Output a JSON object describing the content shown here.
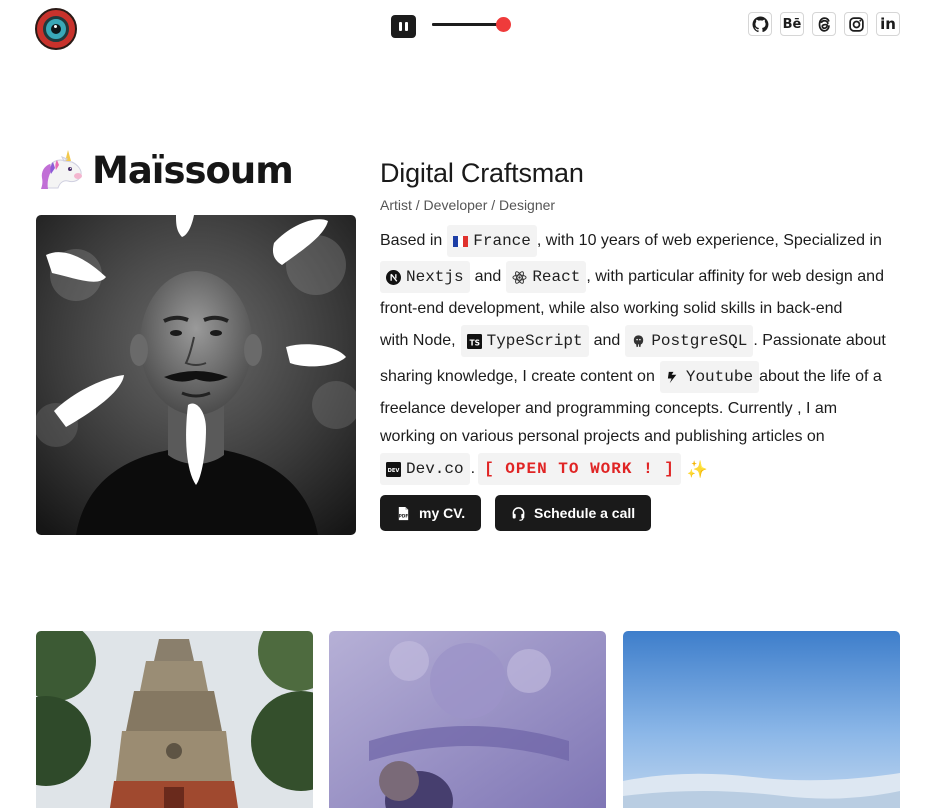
{
  "header": {
    "logo_icon": "eye-logo-icon",
    "pause_icon": "pause-icon",
    "volume_level": 0.9,
    "accent_color": "#ef3b3b",
    "socials": [
      {
        "name": "github",
        "icon": "github-icon"
      },
      {
        "name": "behance",
        "icon": "behance-icon",
        "label": "Bē"
      },
      {
        "name": "threads",
        "icon": "threads-icon"
      },
      {
        "name": "instagram",
        "icon": "instagram-icon"
      },
      {
        "name": "linkedin",
        "icon": "linkedin-icon",
        "label": "in"
      }
    ]
  },
  "hero": {
    "brand_emoji_icon": "unicorn-icon",
    "brand_name": "Maïssoum",
    "title": "Digital Craftsman",
    "subtitle": "Artist / Developer / Designer",
    "bio": {
      "based_in": "Based in",
      "country": "France",
      "experience": ", with 10 years of web experience, Specialized in",
      "nextjs": "Nextjs",
      "and1": "and",
      "react": "React",
      "affinity": ", with particular affinity for web design and",
      "line3": "front-end development, while also working solid skills in back-end",
      "with_node": "with Node,",
      "typescript": "TypeScript",
      "and2": "and",
      "postgresql": "PostgreSQL",
      "passionate": ". Passionate about",
      "sharing": "sharing knowledge, I create content on",
      "youtube": "Youtube",
      "about_life": "about the life of a",
      "line6": "freelance developer and programming concepts. Currently , I am",
      "line7": "working on various personal projects and publishing articles on",
      "devco": "Dev.co",
      "dot": ".",
      "open_to_work": "[ OPEN TO WORK ! ]",
      "sparkles": "✨"
    },
    "buttons": {
      "cv": "my CV.",
      "call": "Schedule a call"
    }
  },
  "gallery": [
    {
      "name": "temple-photo"
    },
    {
      "name": "stone-carving-photo"
    },
    {
      "name": "sky-photo"
    }
  ]
}
